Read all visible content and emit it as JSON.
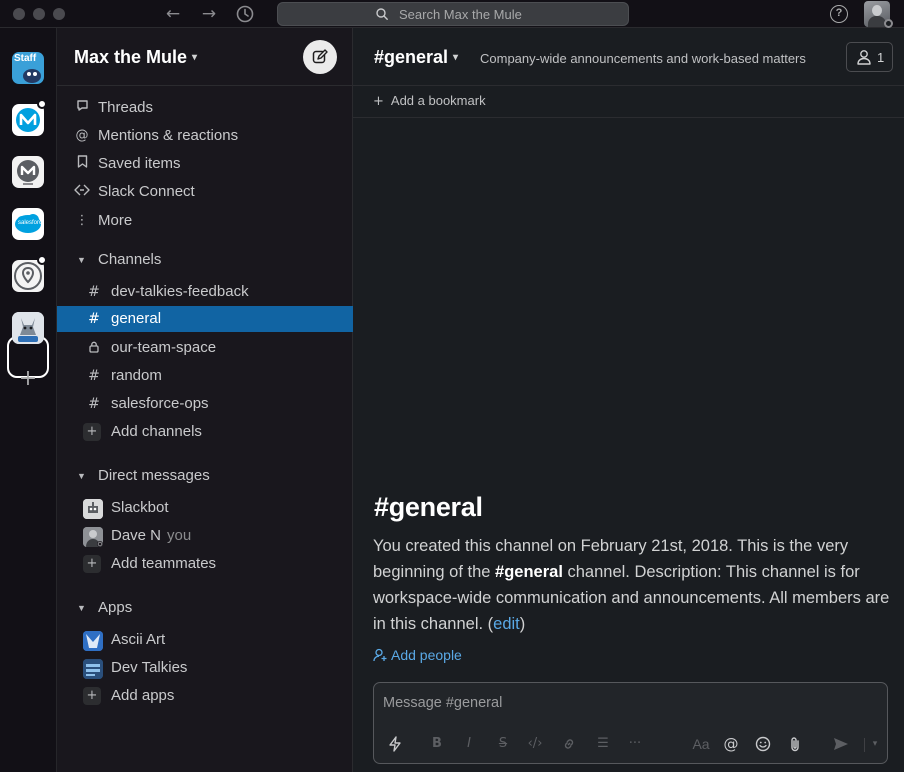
{
  "titlebar": {
    "search_placeholder": "Search Max the Mule",
    "back_icon": "arrow-left-icon",
    "forward_icon": "arrow-right-icon",
    "history_icon": "clock-icon",
    "help_icon": "question-circle-icon"
  },
  "rail": {
    "workspaces": [
      {
        "name": "Staff",
        "icon": "staff-workspace-icon"
      },
      {
        "name": "MuleSoft",
        "icon": "mulesoft-workspace-icon"
      },
      {
        "name": "MuleSoft Community",
        "icon": "mulesoft-community-icon"
      },
      {
        "name": "Salesforce",
        "icon": "salesforce-workspace-icon"
      },
      {
        "name": "Meetups",
        "icon": "meetups-workspace-icon"
      },
      {
        "name": "Max the Mule",
        "icon": "max-the-mule-workspace-icon"
      }
    ],
    "staff_label": "Staff",
    "salesforce_label": "salesforce"
  },
  "sidebar": {
    "workspace_name": "Max the Mule",
    "nav": [
      {
        "label": "Threads",
        "icon": "threads-icon"
      },
      {
        "label": "Mentions & reactions",
        "icon": "at-icon"
      },
      {
        "label": "Saved items",
        "icon": "bookmark-icon"
      },
      {
        "label": "Slack Connect",
        "icon": "slack-connect-icon"
      },
      {
        "label": "More",
        "icon": "more-vertical-icon"
      }
    ],
    "channels_header": "Channels",
    "channels": [
      {
        "name": "dev-talkies-feedback",
        "private": false,
        "active": false
      },
      {
        "name": "general",
        "private": false,
        "active": true
      },
      {
        "name": "our-team-space",
        "private": true,
        "active": false
      },
      {
        "name": "random",
        "private": false,
        "active": false
      },
      {
        "name": "salesforce-ops",
        "private": false,
        "active": false
      }
    ],
    "add_channels": "Add channels",
    "dm_header": "Direct messages",
    "dms": [
      {
        "name": "Slackbot",
        "suffix": ""
      },
      {
        "name": "Dave N",
        "suffix": "you"
      }
    ],
    "add_teammates": "Add teammates",
    "apps_header": "Apps",
    "apps": [
      {
        "name": "Ascii Art"
      },
      {
        "name": "Dev Talkies"
      }
    ],
    "add_apps": "Add apps"
  },
  "channel": {
    "name": "#general",
    "topic": "Company-wide announcements and work-based matters",
    "member_count": "1",
    "add_bookmark": "Add a bookmark",
    "intro_title": "#general",
    "intro_part1": "You created this channel on February 21st, 2018. This is the very beginning of the ",
    "intro_bold": "#general",
    "intro_part2": " channel. Description: This channel is for workspace-wide communication and announcements. All members are in this channel. (",
    "intro_edit": "edit",
    "intro_close": ")",
    "add_people": "Add people",
    "composer_placeholder": "Message #general",
    "composer_tools": [
      "shortcuts-icon",
      "bold-icon",
      "italic-icon",
      "strikethrough-icon",
      "code-icon",
      "link-icon",
      "list-icon",
      "more-formatting-icon",
      "text-format-icon",
      "mention-icon",
      "emoji-icon",
      "attach-icon",
      "send-icon",
      "send-options-icon"
    ],
    "aa_label": "Aa"
  },
  "colors": {
    "active_channel": "#1164a3",
    "link": "#5aa9e6",
    "sidebar_bg": "#19171d",
    "main_bg": "#1a1d21"
  }
}
